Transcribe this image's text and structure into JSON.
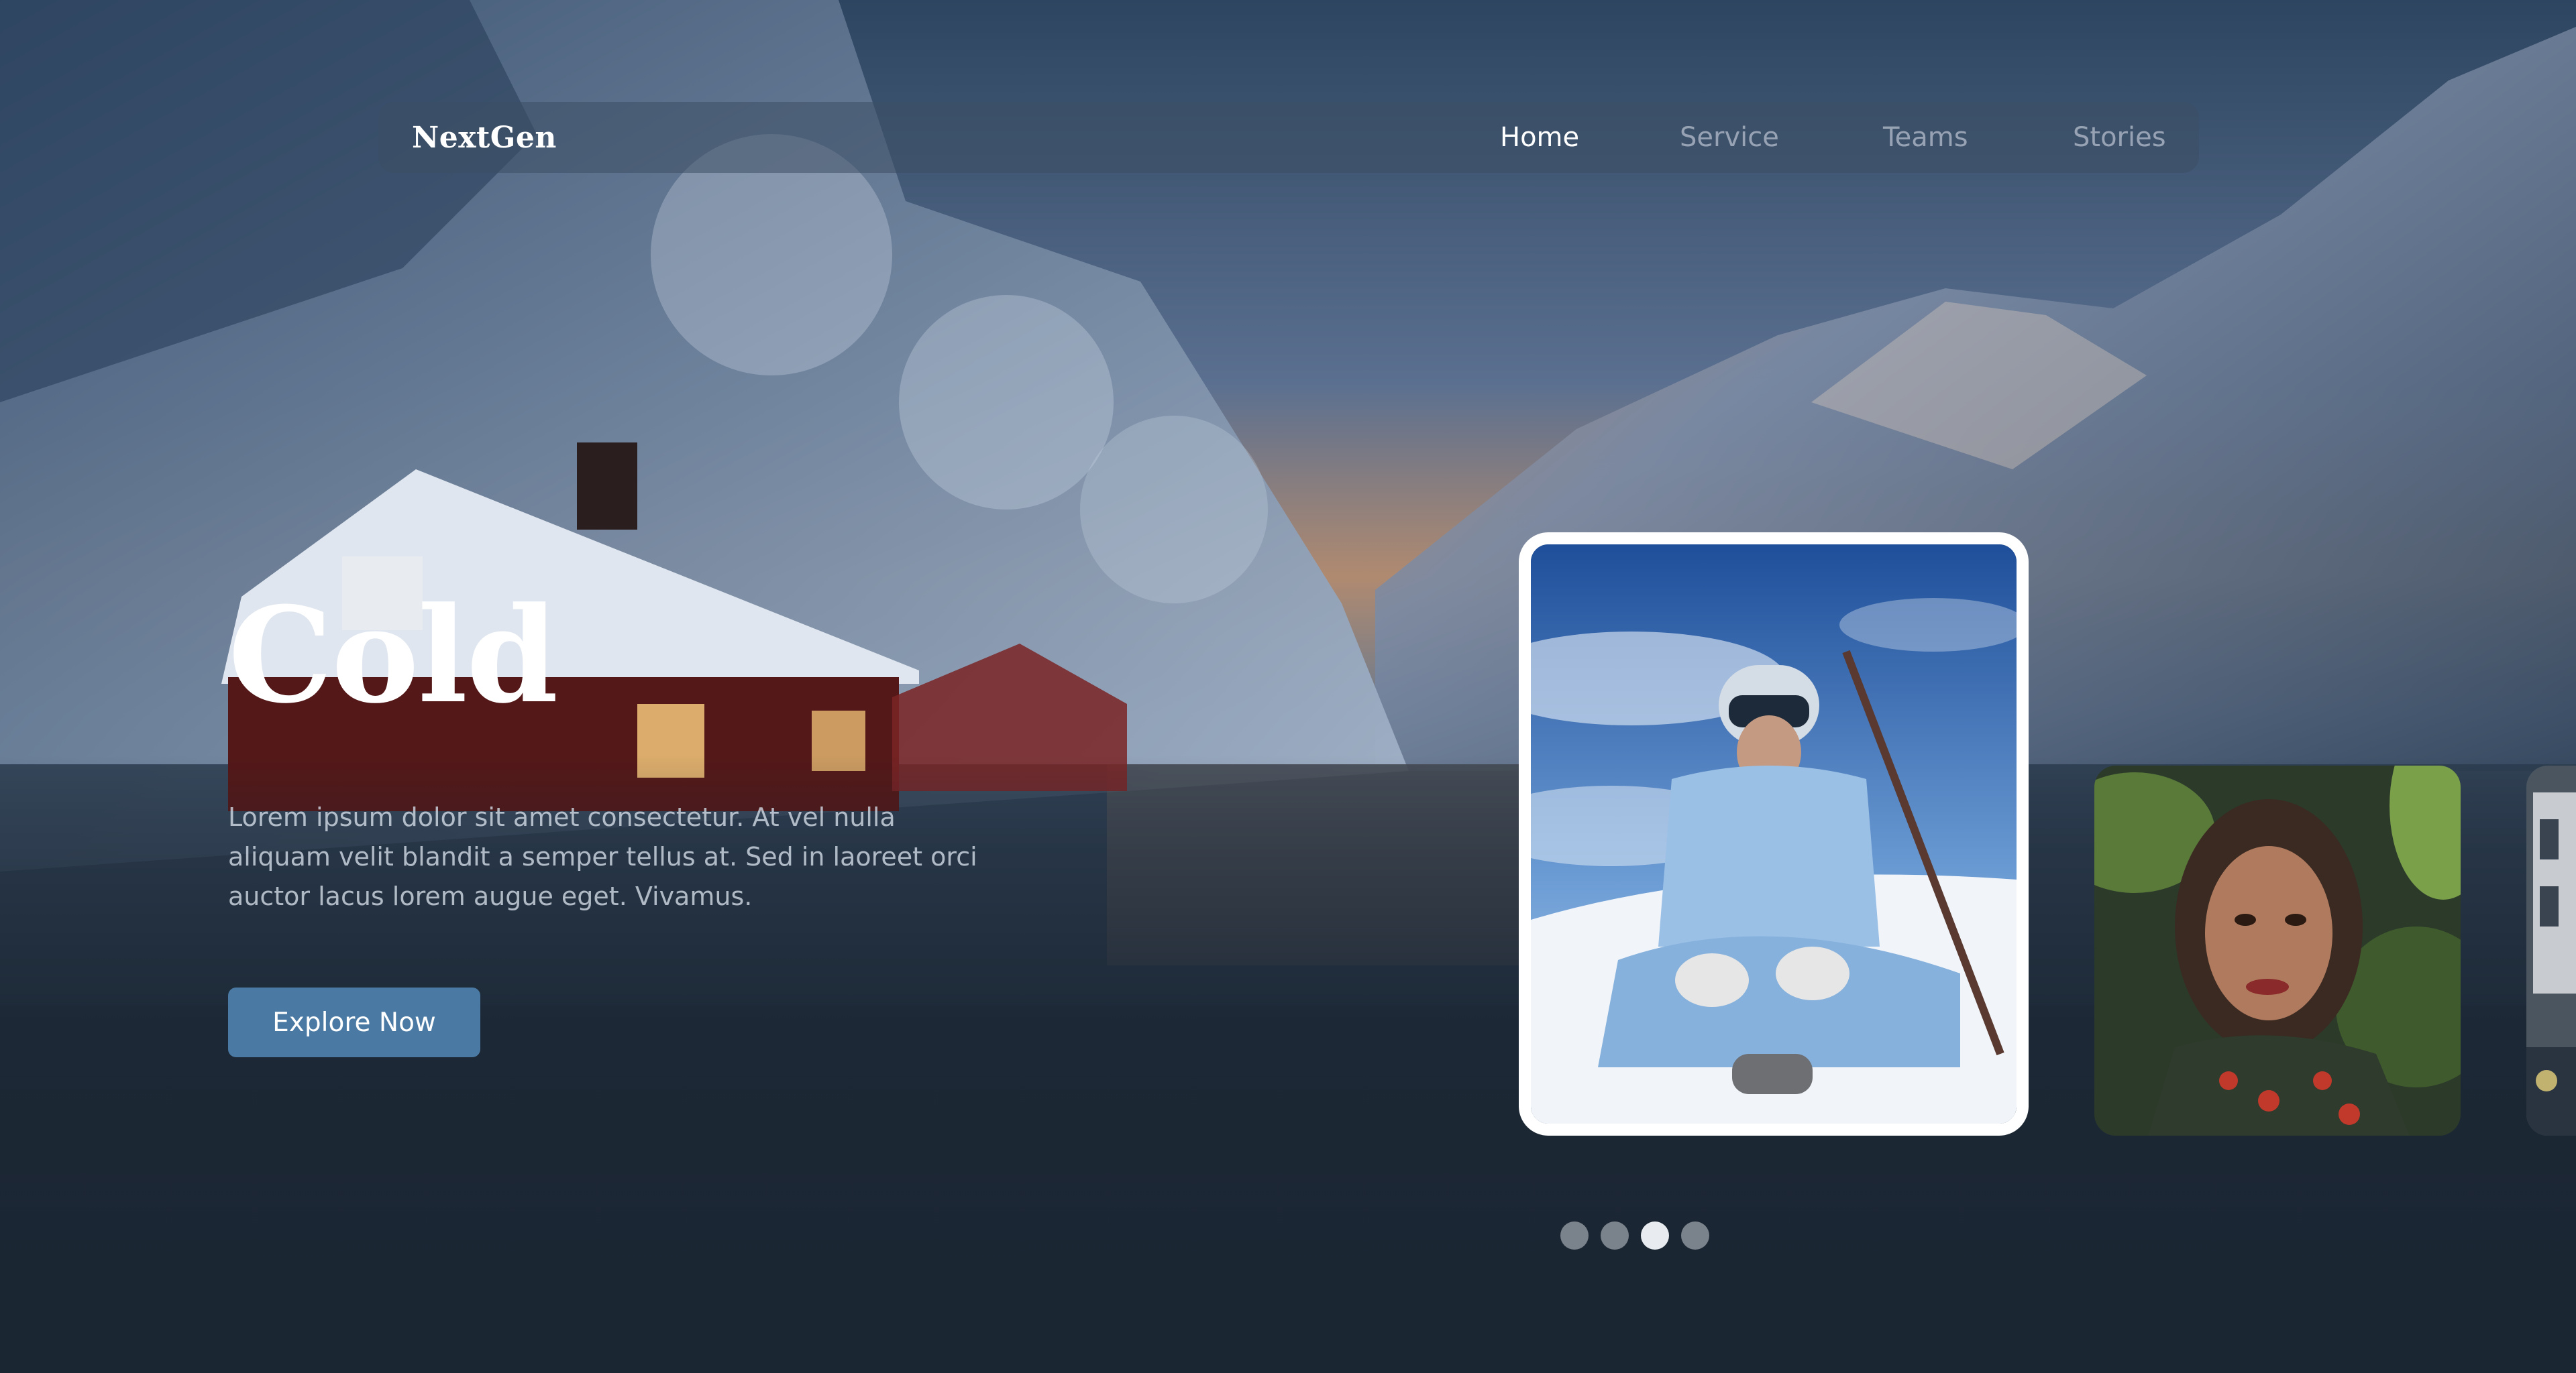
{
  "nav": {
    "brand": "NextGen",
    "links": [
      {
        "label": "Home",
        "active": true
      },
      {
        "label": "Service",
        "active": false
      },
      {
        "label": "Teams",
        "active": false
      },
      {
        "label": "Stories",
        "active": false
      }
    ]
  },
  "hero": {
    "title": "Cold",
    "description": "Lorem ipsum dolor sit amet consectetur. At vel nulla aliquam velit blandit a semper tellus at. Sed in laoreet orci auctor lacus lorem augue eget. Vivamus.",
    "cta_label": "Explore Now"
  },
  "carousel": {
    "active_index": 3,
    "total": 4
  },
  "colors": {
    "accent": "#4a7aa4",
    "background": "#1b2633"
  }
}
